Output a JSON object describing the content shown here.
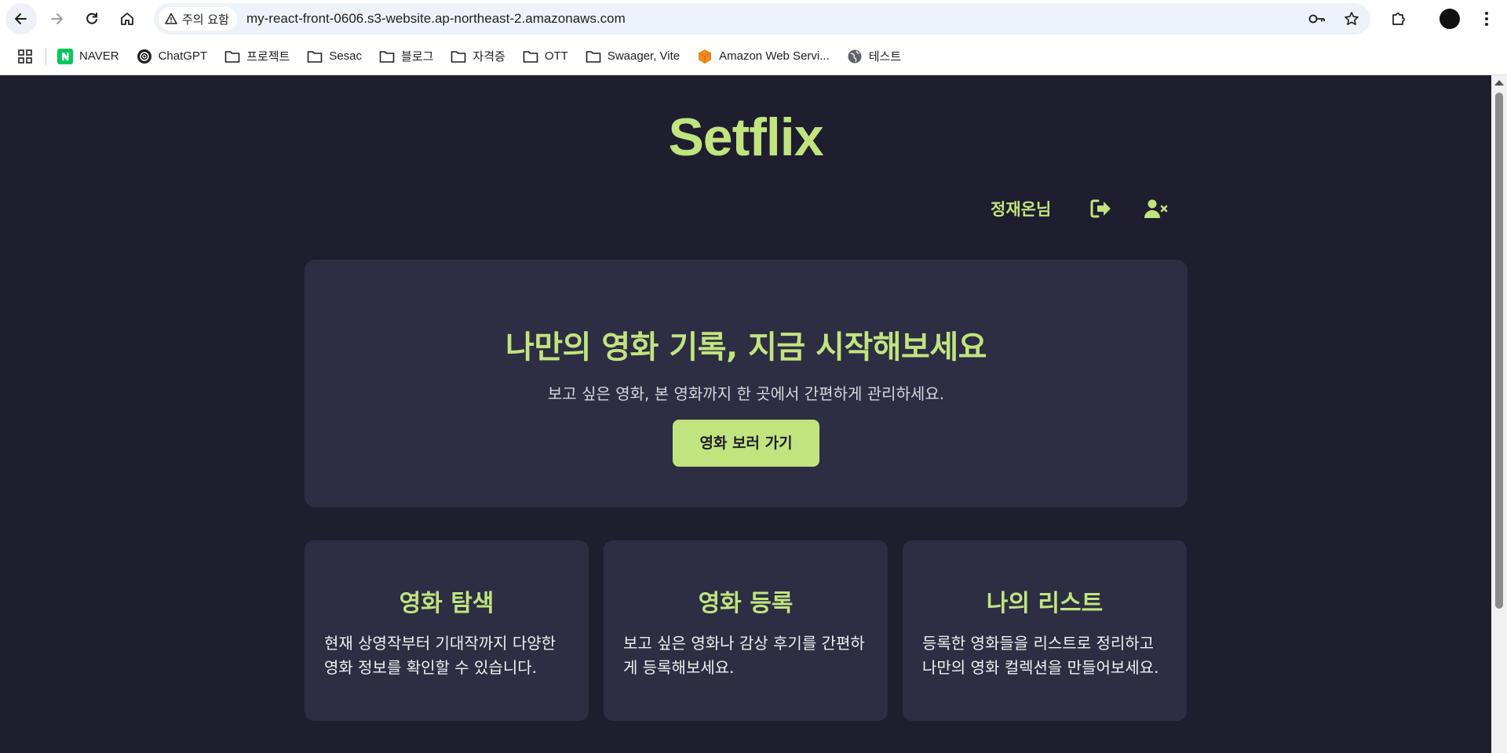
{
  "browser": {
    "security_chip": "주의 요함",
    "url": "my-react-front-0606.s3-website.ap-northeast-2.amazonaws.com",
    "bookmarks": [
      {
        "label": "NAVER",
        "icon": "naver-icon"
      },
      {
        "label": "ChatGPT",
        "icon": "chatgpt-icon"
      },
      {
        "label": "프로젝트",
        "icon": "folder-icon"
      },
      {
        "label": "Sesac",
        "icon": "folder-icon"
      },
      {
        "label": "블로그",
        "icon": "folder-icon"
      },
      {
        "label": "자격증",
        "icon": "folder-icon"
      },
      {
        "label": "OTT",
        "icon": "folder-icon"
      },
      {
        "label": "Swaager, Vite",
        "icon": "folder-icon"
      },
      {
        "label": "Amazon Web Servi...",
        "icon": "aws-icon"
      },
      {
        "label": "테스트",
        "icon": "globe-icon"
      }
    ]
  },
  "app": {
    "logo": "Setflix",
    "user_name": "정재온님",
    "accent_color": "#c1e47f",
    "background_color": "#1e1e2e",
    "card_color": "#2d2d44"
  },
  "hero": {
    "title": "나만의 영화 기록, 지금 시작해보세요",
    "subtitle": "보고 싶은 영화, 본 영화까지 한 곳에서 간편하게 관리하세요.",
    "button_label": "영화 보러 가기"
  },
  "features": [
    {
      "title": "영화 탐색",
      "text": "현재 상영작부터 기대작까지 다양한 영화 정보를 확인할 수 있습니다."
    },
    {
      "title": "영화 등록",
      "text": "보고 싶은 영화나 감상 후기를 간편하게 등록해보세요."
    },
    {
      "title": "나의 리스트",
      "text": "등록한 영화들을 리스트로 정리하고 나만의 영화 컬렉션을 만들어보세요."
    }
  ]
}
